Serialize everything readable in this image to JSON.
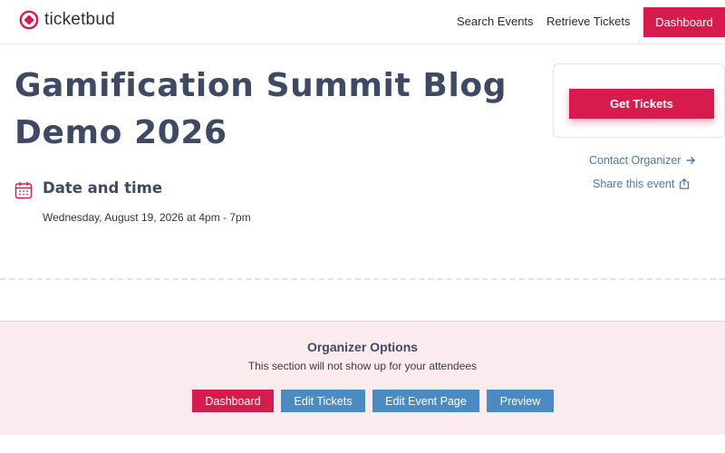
{
  "header": {
    "brand_name": "ticketbud",
    "brand_icon": "ticketbud-logo-icon",
    "nav": {
      "search_events": "Search Events",
      "retrieve_tickets": "Retrieve Tickets",
      "dashboard": "Dashboard"
    }
  },
  "event": {
    "title": "Gamification Summit Blog Demo 2026",
    "date_time_heading": "Date and time",
    "date_time_value": "Wednesday, August 19, 2026 at 4pm - 7pm",
    "date_icon": "calendar-icon"
  },
  "sidebar": {
    "get_tickets_label": "Get Tickets",
    "contact_organizer_label": "Contact Organizer",
    "contact_icon": "arrow-right-icon",
    "share_event_label": "Share this event",
    "share_icon": "share-icon"
  },
  "organizer_options": {
    "title": "Organizer Options",
    "subtitle": "This section will not show up for your attendees",
    "buttons": [
      {
        "label": "Dashboard"
      },
      {
        "label": "Edit Tickets"
      },
      {
        "label": "Edit Event Page"
      },
      {
        "label": "Preview"
      }
    ]
  },
  "colors": {
    "brand_pink": "#d81b4d",
    "action_blue": "#4a8bc2",
    "link_blue": "#4a7aa8",
    "heading_slate": "#3e4a63",
    "panel_pink": "#fcebee"
  }
}
